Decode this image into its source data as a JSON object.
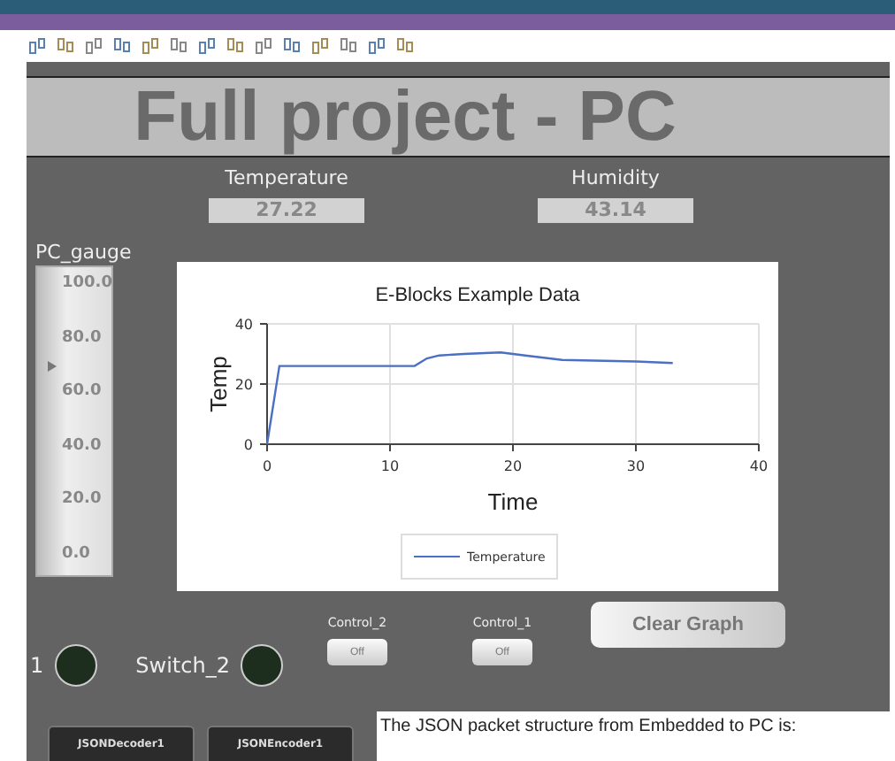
{
  "title": "Full project - PC",
  "readouts": [
    {
      "label": "Temperature",
      "value": "27.22"
    },
    {
      "label": "Humidity",
      "value": "43.14"
    }
  ],
  "gauge": {
    "label": "PC_gauge",
    "ticks": [
      "100.0",
      "80.0",
      "60.0",
      "40.0",
      "20.0",
      "0.0"
    ]
  },
  "chart": {
    "chart_data": {
      "type": "line",
      "grid": true,
      "title": "E-Blocks Example Data",
      "xlabel": "Time",
      "ylabel": "Temp",
      "xlim": [
        0,
        40
      ],
      "ylim": [
        0,
        40
      ],
      "xticks": [
        0,
        10,
        20,
        30,
        40
      ],
      "yticks": [
        0,
        20,
        40
      ],
      "x": [
        0,
        1,
        12,
        13,
        14,
        16,
        19,
        21,
        24,
        30,
        33
      ],
      "series": [
        {
          "name": "Temperature",
          "color": "#4a6fc4",
          "values": [
            0,
            26,
            26,
            28.5,
            29.5,
            30,
            30.5,
            29.5,
            28,
            27.5,
            27
          ]
        }
      ]
    }
  },
  "switches": [
    {
      "label": "1",
      "on": false
    },
    {
      "label": "Switch_2",
      "on": false
    }
  ],
  "controls": [
    {
      "label": "Control_2",
      "state": "Off",
      "on": false
    },
    {
      "label": "Control_1",
      "state": "Off",
      "on": false
    }
  ],
  "clear_button": "Clear Graph",
  "components": [
    "JSONDecoder1",
    "JSONEncoder1"
  ],
  "description": "The JSON packet structure from Embedded to PC is:"
}
